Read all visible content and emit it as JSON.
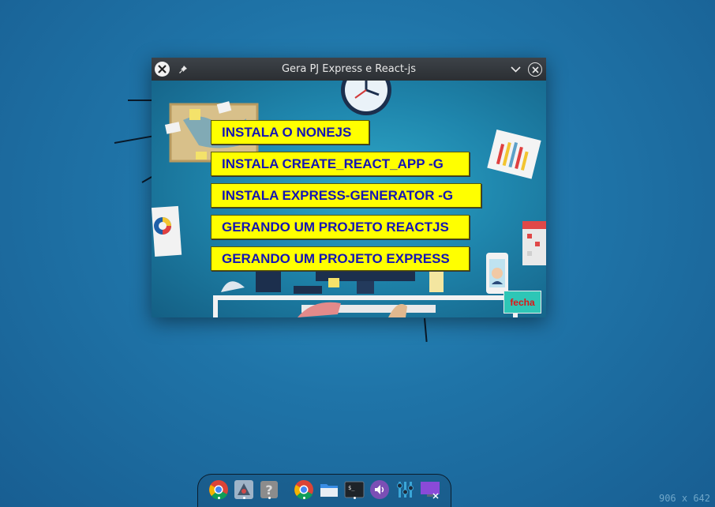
{
  "window": {
    "title": "Gera PJ Express e React-js",
    "menu_buttons": [
      "INSTALA O NONEJS",
      "INSTALA CREATE_REACT_APP -G",
      "INSTALA EXPRESS-GENERATOR -G",
      "GERANDO UM PROJETO REACTJS",
      "GERANDO UM PROJETO EXPRESS"
    ],
    "close_label": "fecha"
  },
  "colors": {
    "button_bg": "#ffff00",
    "button_text": "#1414b4",
    "close_bg": "#2ec6b6",
    "close_text": "#e01414",
    "titlebar": "#2b2f33"
  },
  "dock": {
    "icons": [
      "chrome-icon",
      "network-icon",
      "help-icon",
      "chrome-icon",
      "files-icon",
      "terminal-icon",
      "volume-icon",
      "settings-icon",
      "display-icon"
    ]
  },
  "status": {
    "resolution": "906 x 642"
  }
}
